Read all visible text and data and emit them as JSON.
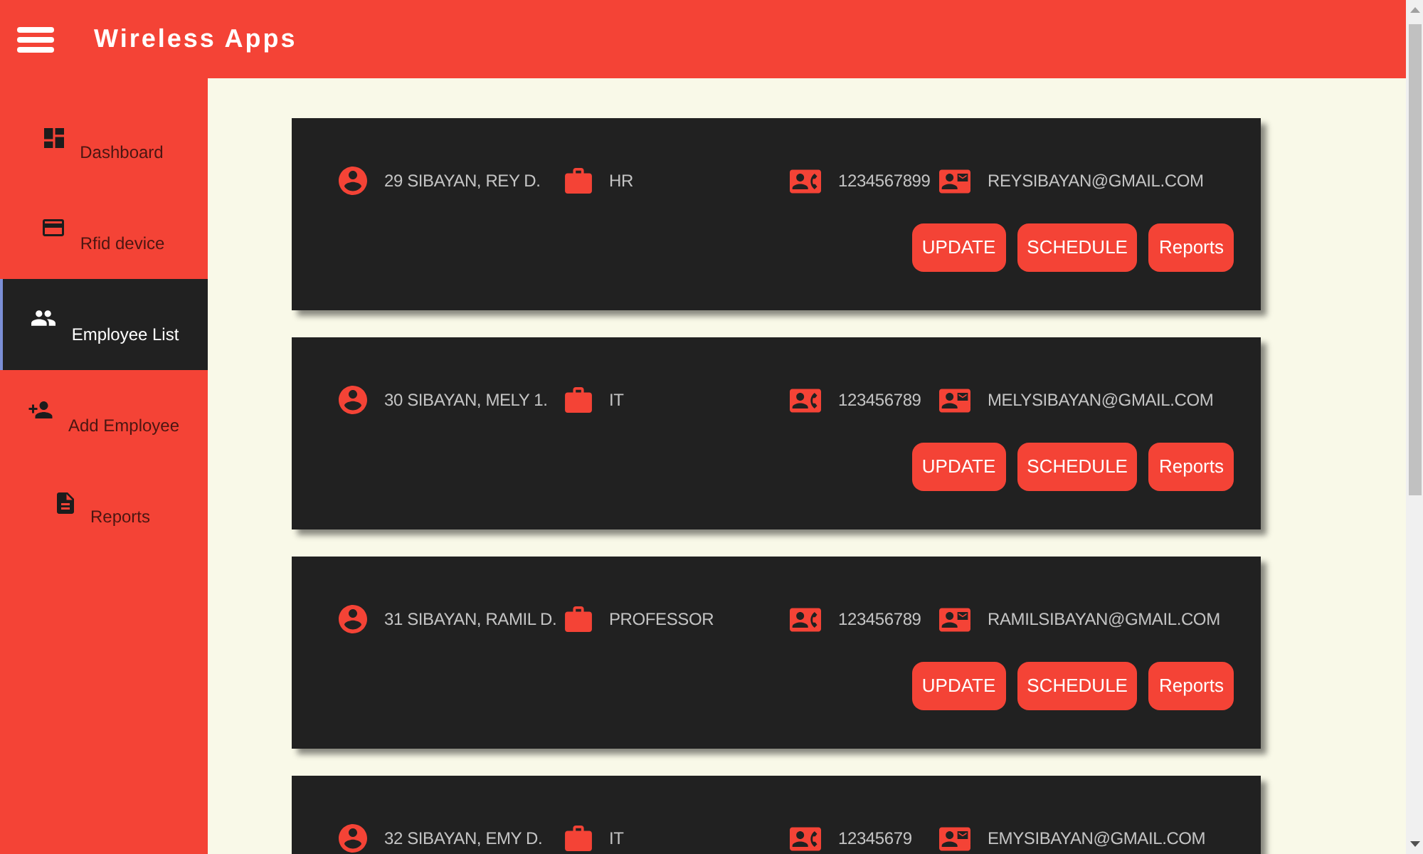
{
  "header": {
    "title": "Wireless Apps"
  },
  "sidebar": {
    "items": [
      {
        "label": "Dashboard",
        "selected": false
      },
      {
        "label": "Rfid device",
        "selected": false
      },
      {
        "label": "Employee List",
        "selected": true
      },
      {
        "label": "Add Employee",
        "selected": false
      },
      {
        "label": "Reports",
        "selected": false
      }
    ]
  },
  "employees": [
    {
      "name": "29 SIBAYAN, REY D.",
      "department": "HR",
      "phone": "1234567899",
      "email": "REYSIBAYAN@GMAIL.COM",
      "buttons": [
        "UPDATE",
        "SCHEDULE",
        "Reports"
      ]
    },
    {
      "name": "30 SIBAYAN, MELY 1.",
      "department": "IT",
      "phone": "123456789",
      "email": "MELYSIBAYAN@GMAIL.COM",
      "buttons": [
        "UPDATE",
        "SCHEDULE",
        "Reports"
      ]
    },
    {
      "name": "31 SIBAYAN, RAMIL D.",
      "department": "PROFESSOR",
      "phone": "123456789",
      "email": "RAMILSIBAYAN@GMAIL.COM",
      "buttons": [
        "UPDATE",
        "SCHEDULE",
        "Reports"
      ]
    },
    {
      "name": "32 SIBAYAN, EMY D.",
      "department": "IT",
      "phone": "12345679",
      "email": "EMYSIBAYAN@GMAIL.COM"
    }
  ]
}
